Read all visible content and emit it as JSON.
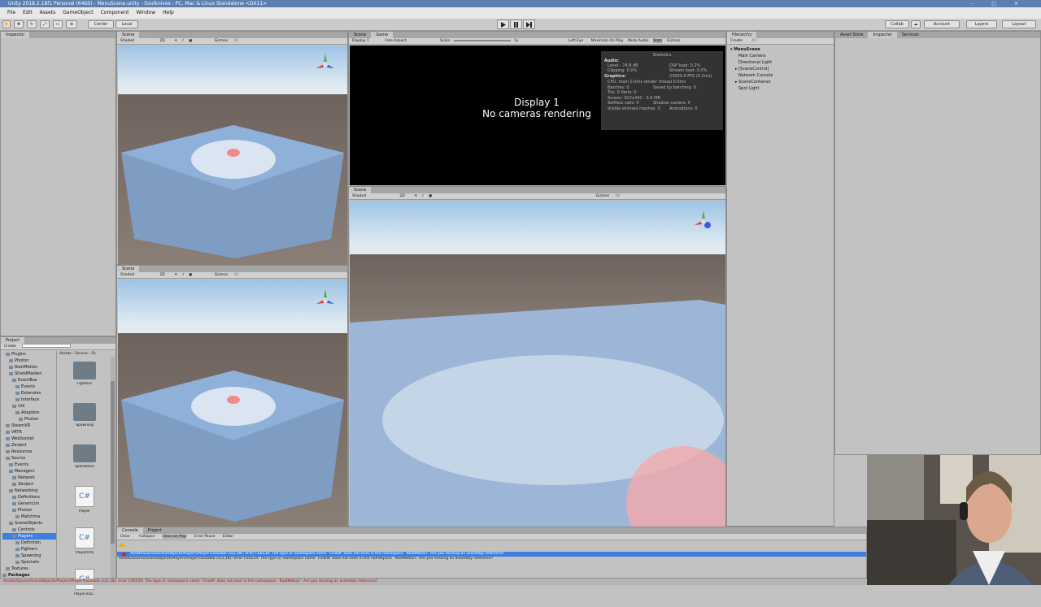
{
  "window": {
    "title": "Unity 2018.2.18f1 Personal (64bit) - MenuScene.unity - Soulknives - PC, Mac & Linux Standalone <DX11>"
  },
  "menu": [
    "File",
    "Edit",
    "Assets",
    "GameObject",
    "Component",
    "Window",
    "Help"
  ],
  "toolbar": {
    "center_label": "Center",
    "local_label": "Local",
    "collab_label": "Collab",
    "account_label": "Account",
    "layers_label": "Layers",
    "layout_label": "Layout"
  },
  "left_inspector": {
    "tab": "Inspector"
  },
  "scene_views": [
    {
      "tab": "Scene",
      "shading": "Shaded",
      "mode": "2D",
      "gizmos": "Gizmos",
      "search": "All"
    },
    {
      "tab": "Scene",
      "shading": "Shaded",
      "mode": "2D",
      "gizmos": "Gizmos",
      "search": "All"
    }
  ],
  "game_view": {
    "tabs": [
      "Scene",
      "Game"
    ],
    "display": "Display 1",
    "aspect": "Free Aspect",
    "scale_label": "Scale",
    "scale_value": "1x",
    "eye": "Left Eye",
    "options": [
      "Maximize On Play",
      "Mute Audio",
      "Stats",
      "Gizmos"
    ],
    "message_line1": "Display 1",
    "message_line2": "No cameras rendering"
  },
  "stats": {
    "title": "Statistics",
    "audio_label": "Audio:",
    "level": "Level: -74.8 dB",
    "clipping": "Clipping: 0.0%",
    "dsp": "DSP load: 0.2%",
    "stream": "Stream load: 0.0%",
    "graphics_label": "Graphics:",
    "fps": "23000.0 FPS (0.0ms)",
    "cpu": "CPU: main 0.0ms  render thread 0.0ms",
    "batches": "Batches: 0",
    "saved": "Saved by batching: 0",
    "tris": "Tris: 0    Verts: 0",
    "screen": "Screen: 922x342 - 3.6 MB",
    "setpass": "SetPass calls: 0",
    "shadow": "Shadow casters: 0",
    "skinned": "Visible skinned meshes: 0",
    "anim": "Animations: 0"
  },
  "scene_large": {
    "tab": "Scene",
    "shading": "Shaded",
    "mode": "2D",
    "gizmos": "Gizmos",
    "search": "All"
  },
  "hierarchy": {
    "tab": "Hierarchy",
    "create": "Create",
    "search": "All",
    "scene": "MenuScene",
    "items": [
      "Main Camera",
      "Directional Light",
      "[SceneControl]",
      "Network Console",
      "SceneContainer",
      "Spot Light"
    ]
  },
  "right_tabs": [
    "Asset Store",
    "Inspector",
    "Services"
  ],
  "project": {
    "tab": "Project",
    "create": "Create",
    "breadcrumb": [
      "Assets",
      "Source",
      "Sc"
    ],
    "tree": [
      "Plugins",
      "Photon",
      "RootMotion",
      "ShieldMaiden",
      "EventBus",
      "Events",
      "Extension",
      "Interface",
      "Util",
      "Adapters",
      "Photon",
      "SteamVR",
      "VRTK",
      "WebSocket",
      "Zenject",
      "Resources",
      "Source",
      "Events",
      "Managers",
      "Network",
      "Zenject",
      "Networking",
      "Definitions",
      "Generic(m",
      "Photon",
      "Matchma",
      "SceneObjects",
      "Controls",
      "Players",
      "Definition",
      "Fighters",
      "Spawning",
      "Spectato",
      "Textures",
      "Packages"
    ],
    "assets": [
      {
        "name": "Fighters",
        "kind": "folder"
      },
      {
        "name": "Spawning",
        "kind": "folder"
      },
      {
        "name": "Spectators",
        "kind": "folder"
      },
      {
        "name": "Player",
        "kind": "script"
      },
      {
        "name": "PlayerInfo",
        "kind": "script"
      },
      {
        "name": "PlayerTrac..",
        "kind": "script"
      }
    ],
    "script_glyph": "C#"
  },
  "console": {
    "tabs": [
      "Console",
      "Project"
    ],
    "buttons": [
      "Clear",
      "Collapse",
      "Clear on Play",
      "Error Pause",
      "Editor"
    ],
    "errors": [
      "Assets/Source/SceneObjects/Players/PlayerTrackable.cs(2,18): error CS0234: The type or namespace name `FinalIK' does not exist in the namespace `RootMotion'. Are you missing an assembly reference?",
      "Assets/Source/SceneObjects/Players/PlayerTrackable.cs(2,18): error CS0234: The type or namespace name `FinalIK' does not exist in the namespace `RootMotion'. Are you missing an assembly reference?"
    ]
  },
  "status": {
    "message": "Assets/Source/SceneObjects/Players/PlayerTrackable.cs(2,18): error CS0234: The type or namespace name `FinalIK' does not exist in the namespace `RootMotion'. Are you missing an assembly reference?"
  },
  "colors": {
    "title_bar": "#5b7fb0",
    "error_row": "#3d7fe0",
    "error_text": "#cc0000",
    "game_bg": "#000000"
  }
}
